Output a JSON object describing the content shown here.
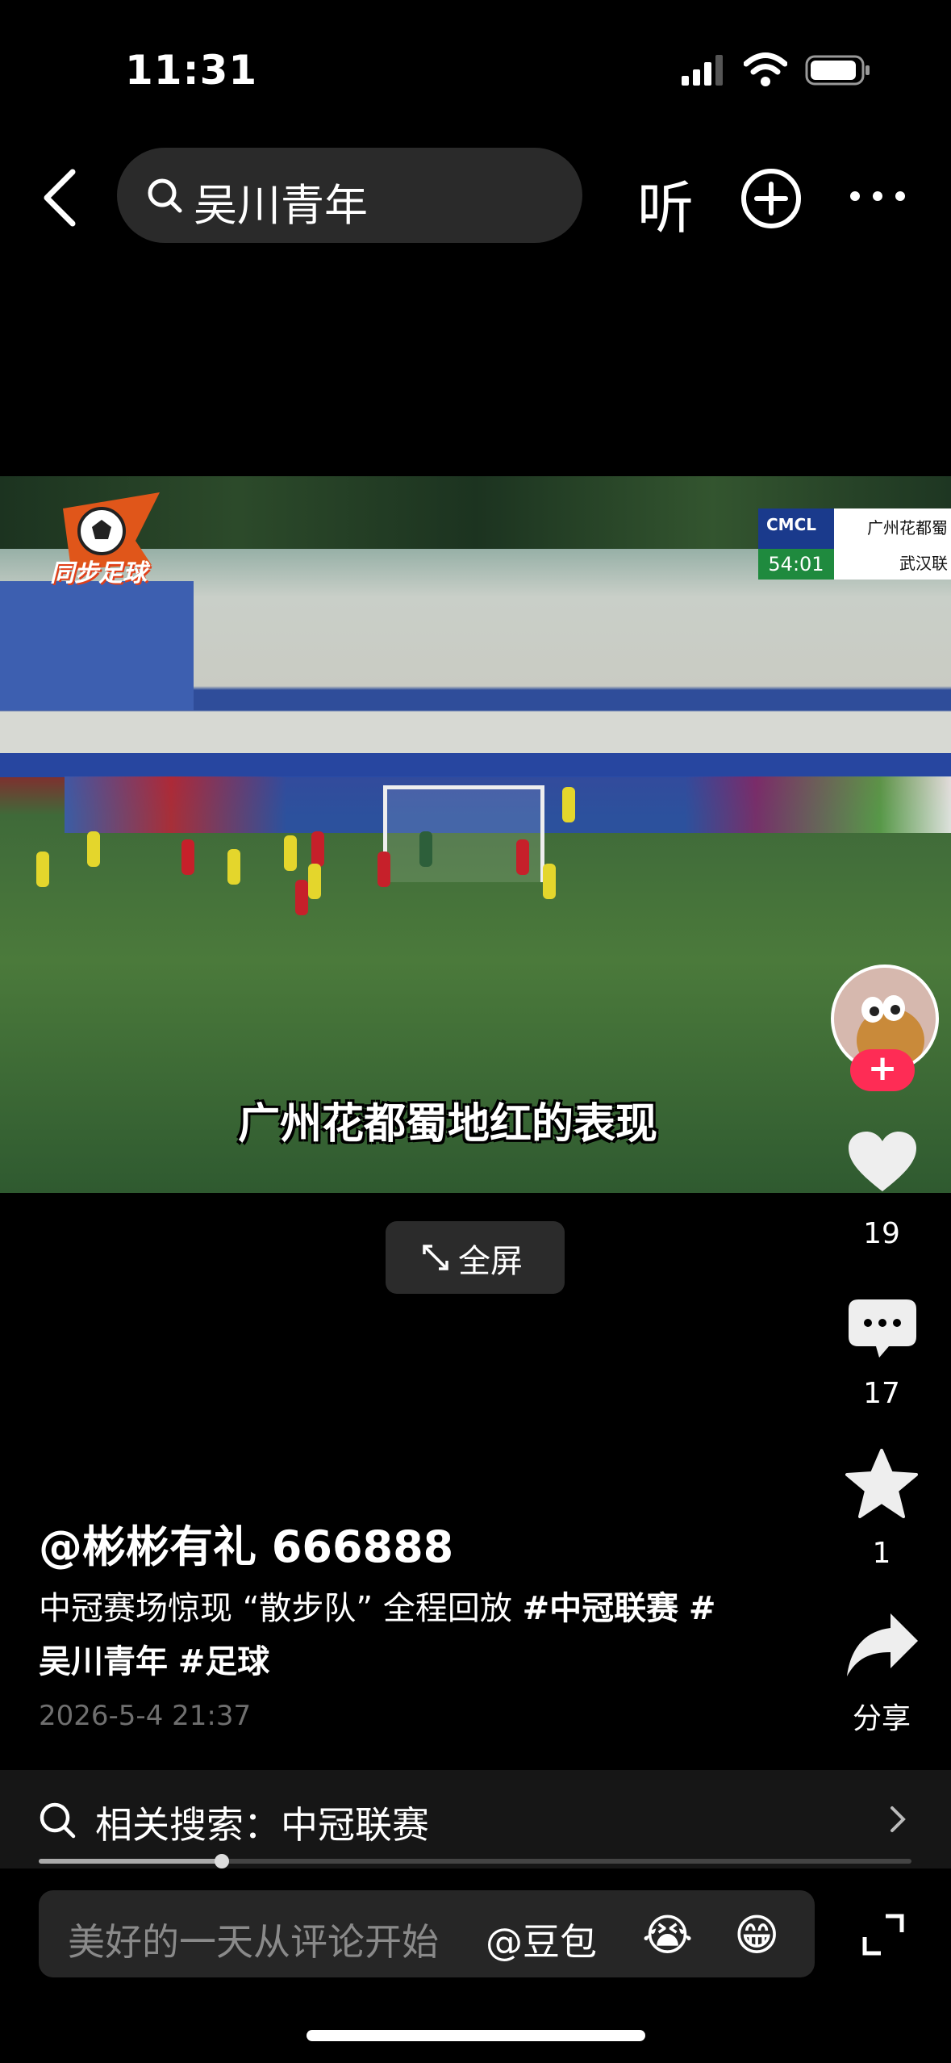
{
  "status_bar": {
    "time": "11:31"
  },
  "header": {
    "search_query": "吴川青年",
    "listen_label": "听"
  },
  "video": {
    "watermark": "同步足球",
    "scoreboard": {
      "league": "CMCL",
      "clock": "54:01",
      "team1": "广州花都蜀",
      "team2": "武汉联"
    },
    "subtitle": "广州花都蜀地红的表现",
    "fullscreen_label": "全屏"
  },
  "actions": {
    "likes": "19",
    "comments": "17",
    "favorites": "1",
    "share_label": "分享"
  },
  "post": {
    "author": "@彬彬有礼 666888",
    "caption_text": "中冠赛场惊现 “散步队” 全程回放",
    "tags": [
      "#中冠联赛",
      "#",
      "吴川青年",
      "#足球"
    ],
    "date": "2026-5-4 21:37"
  },
  "related_search": {
    "label": "相关搜索：中冠联赛"
  },
  "playback": {
    "progress": 0.21
  },
  "comment_bar": {
    "placeholder": "美好的一天从评论开始",
    "mention": "@豆包",
    "emoji1": "😭",
    "emoji2": "😁"
  }
}
